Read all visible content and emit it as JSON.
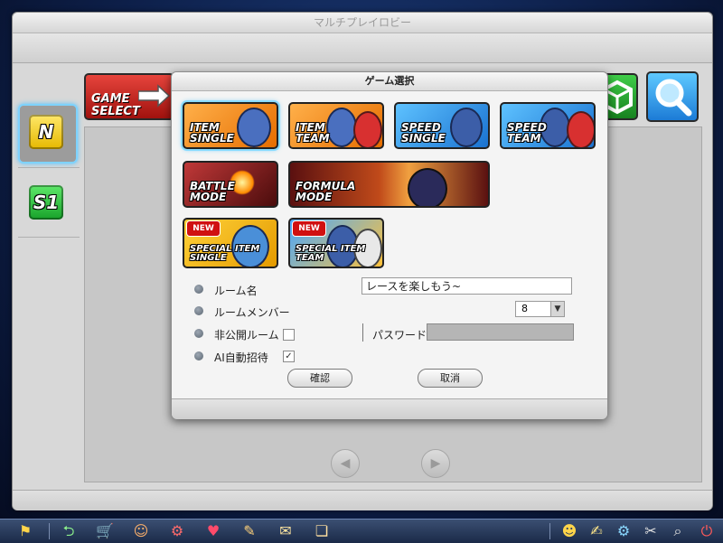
{
  "lobby": {
    "title": "マルチプレイロビー",
    "game_select_label": "GAME\nSELECT",
    "badges": {
      "n": "N",
      "s1": "S1"
    },
    "nav_prev": "◀",
    "nav_next": "▶"
  },
  "dialog": {
    "title": "ゲーム選択",
    "modes": [
      {
        "label": "ITEM\nSINGLE",
        "selected": true
      },
      {
        "label": "ITEM\nTEAM"
      },
      {
        "label": "SPEED\nSINGLE"
      },
      {
        "label": "SPEED\nTEAM"
      },
      {
        "label": "BATTLE\nMODE"
      },
      {
        "label": "FORMULA\nMODE"
      },
      {
        "label": "SPECIAL ITEM\nSINGLE",
        "badge": "NEW"
      },
      {
        "label": "SPECIAL ITEM\nTEAM",
        "badge": "NEW"
      }
    ],
    "form": {
      "room_name_label": "ルーム名",
      "room_name_value": "レースを楽しもう~",
      "room_member_label": "ルームメンバー",
      "room_member_value": "8",
      "private_room_label": "非公開ルーム",
      "ai_invite_label": "AI自動招待",
      "ai_invite_checked": "✓",
      "password_label": "パスワード"
    },
    "confirm_label": "確認",
    "cancel_label": "取消"
  },
  "taskbar": {
    "icons_left": [
      "flag-icon",
      "back-icon",
      "cart-icon",
      "character-icon",
      "kart-icon",
      "heart-icon",
      "wrench-icon",
      "scroll-icon",
      "book-icon"
    ],
    "icons_right": [
      "face-icon",
      "note-icon",
      "gear-icon",
      "tools-icon",
      "search-icon",
      "power-icon"
    ]
  }
}
